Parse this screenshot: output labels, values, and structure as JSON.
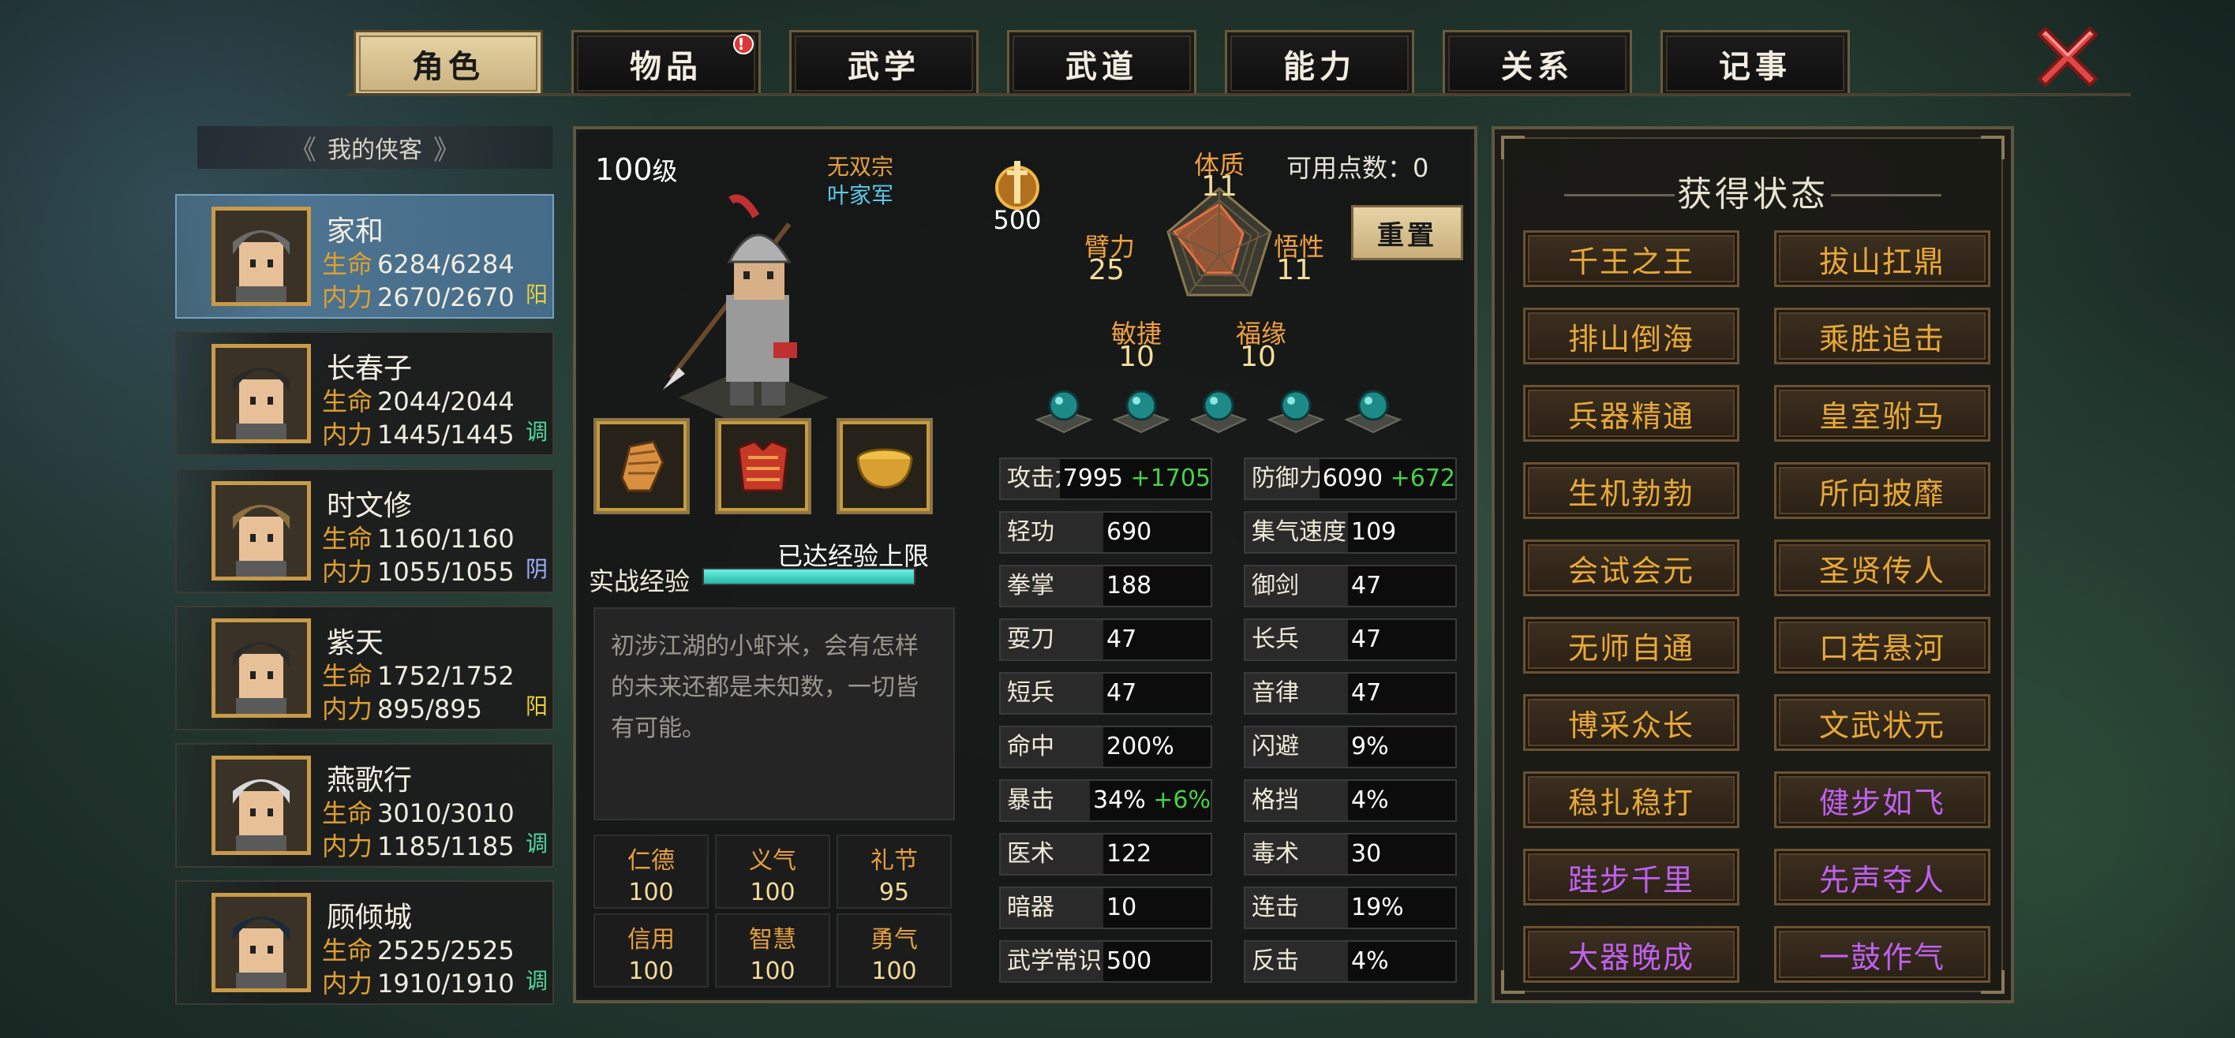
{
  "tabs": [
    {
      "label": "角色",
      "active": true
    },
    {
      "label": "物品",
      "badge": "!"
    },
    {
      "label": "武学"
    },
    {
      "label": "武道"
    },
    {
      "label": "能力"
    },
    {
      "label": "关系"
    },
    {
      "label": "记事"
    }
  ],
  "close_icon": "close-x-icon",
  "list_header": "我的侠客",
  "heroes": [
    {
      "name": "家和",
      "hp_label": "生命",
      "hp": "6284/6284",
      "mp_label": "内力",
      "mp": "2670/2670",
      "type": "阳",
      "type_color": "#e8d040",
      "active": true
    },
    {
      "name": "长春子",
      "hp_label": "生命",
      "hp": "2044/2044",
      "mp_label": "内力",
      "mp": "1445/1445",
      "type": "调",
      "type_color": "#50d8a0"
    },
    {
      "name": "时文修",
      "hp_label": "生命",
      "hp": "1160/1160",
      "mp_label": "内力",
      "mp": "1055/1055",
      "type": "阴",
      "type_color": "#a0b0ff"
    },
    {
      "name": "紫天",
      "hp_label": "生命",
      "hp": "1752/1752",
      "mp_label": "内力",
      "mp": "895/895",
      "type": "阳",
      "type_color": "#e8d040"
    },
    {
      "name": "燕歌行",
      "hp_label": "生命",
      "hp": "3010/3010",
      "mp_label": "内力",
      "mp": "1185/1185",
      "type": "调",
      "type_color": "#50d8a0"
    },
    {
      "name": "顾倾城",
      "hp_label": "生命",
      "hp": "2525/2525",
      "mp_label": "内力",
      "mp": "1910/1910",
      "type": "调",
      "type_color": "#50d8a0"
    }
  ],
  "character": {
    "level_num": "100",
    "level_unit": "级",
    "sect": "无双宗",
    "clan": "叶家军",
    "exp_label": "实战经验",
    "exp_text": "已达经验上限",
    "exp_fill": 1.0,
    "description": "初涉江湖的小虾米，会有怎样的未来还都是未知数，一切皆有可能。",
    "equipment": [
      "gauntlet-icon",
      "armor-icon",
      "bowl-icon"
    ],
    "virtues": [
      {
        "name": "仁德",
        "value": "100"
      },
      {
        "name": "义气",
        "value": "100"
      },
      {
        "name": "礼节",
        "value": "95"
      },
      {
        "name": "信用",
        "value": "100"
      },
      {
        "name": "智慧",
        "value": "100"
      },
      {
        "name": "勇气",
        "value": "100"
      }
    ],
    "points_value": "500",
    "available_points": "可用点数：0",
    "reset_label": "重置",
    "attributes": {
      "tizhi": {
        "label": "体质",
        "value": "11"
      },
      "wuxing": {
        "label": "悟性",
        "value": "11"
      },
      "fuyuan": {
        "label": "福缘",
        "value": "10"
      },
      "minjie": {
        "label": "敏捷",
        "value": "10"
      },
      "bili": {
        "label": "臂力",
        "value": "25"
      }
    },
    "orb_count": 5,
    "stats_left": [
      {
        "name": "攻击力",
        "value": "7995",
        "bonus": "+1705"
      },
      {
        "name": "轻功",
        "value": "690"
      },
      {
        "name": "拳掌",
        "value": "188"
      },
      {
        "name": "耍刀",
        "value": "47"
      },
      {
        "name": "短兵",
        "value": "47"
      },
      {
        "name": "命中",
        "value": "200%"
      },
      {
        "name": "暴击",
        "value": "34%",
        "bonus": "+6%"
      },
      {
        "name": "医术",
        "value": "122"
      },
      {
        "name": "暗器",
        "value": "10"
      },
      {
        "name": "武学常识",
        "value": "500"
      }
    ],
    "stats_right": [
      {
        "name": "防御力",
        "value": "6090",
        "bonus": "+672"
      },
      {
        "name": "集气速度",
        "value": "109"
      },
      {
        "name": "御剑",
        "value": "47"
      },
      {
        "name": "长兵",
        "value": "47"
      },
      {
        "name": "音律",
        "value": "47"
      },
      {
        "name": "闪避",
        "value": "9%"
      },
      {
        "name": "格挡",
        "value": "4%"
      },
      {
        "name": "毒术",
        "value": "30"
      },
      {
        "name": "连击",
        "value": "19%"
      },
      {
        "name": "反击",
        "value": "4%"
      }
    ]
  },
  "status_panel": {
    "title": "获得状态",
    "items": [
      {
        "label": "千王之王",
        "color": "#e8a838"
      },
      {
        "label": "拔山扛鼎",
        "color": "#e8a838"
      },
      {
        "label": "排山倒海",
        "color": "#e8a838"
      },
      {
        "label": "乘胜追击",
        "color": "#e8a838"
      },
      {
        "label": "兵器精通",
        "color": "#e8a838"
      },
      {
        "label": "皇室驸马",
        "color": "#e8a838"
      },
      {
        "label": "生机勃勃",
        "color": "#e8a838"
      },
      {
        "label": "所向披靡",
        "color": "#e8a838"
      },
      {
        "label": "会试会元",
        "color": "#e8a838"
      },
      {
        "label": "圣贤传人",
        "color": "#e8a838"
      },
      {
        "label": "无师自通",
        "color": "#e8a838"
      },
      {
        "label": "口若悬河",
        "color": "#e8a838"
      },
      {
        "label": "博采众长",
        "color": "#e8a838"
      },
      {
        "label": "文武状元",
        "color": "#e8a838"
      },
      {
        "label": "稳扎稳打",
        "color": "#e8a838"
      },
      {
        "label": "健步如飞",
        "color": "#c060f0"
      },
      {
        "label": "跬步千里",
        "color": "#c060f0"
      },
      {
        "label": "先声夺人",
        "color": "#c060f0"
      },
      {
        "label": "大器晚成",
        "color": "#c060f0"
      },
      {
        "label": "一鼓作气",
        "color": "#c060f0"
      }
    ]
  }
}
